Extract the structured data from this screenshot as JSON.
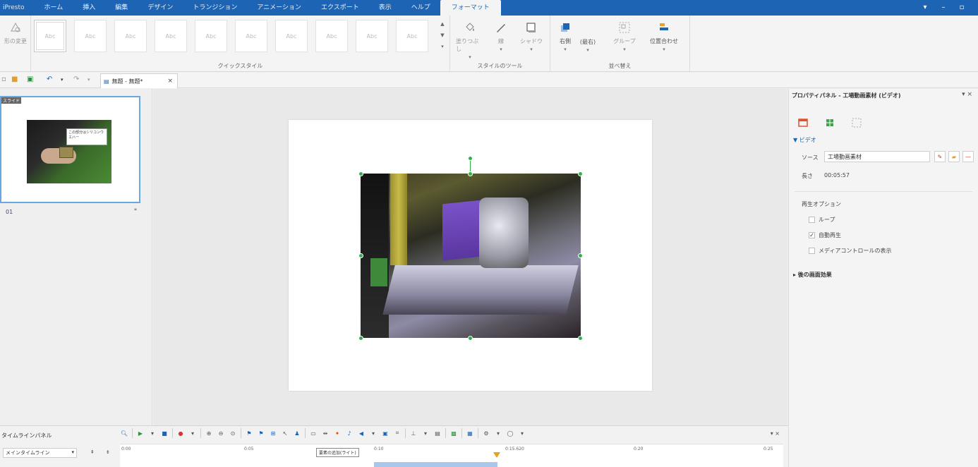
{
  "app": {
    "title": "iPresto"
  },
  "tabs": [
    "ホーム",
    "挿入",
    "編集",
    "デザイン",
    "トランジション",
    "アニメーション",
    "エクスポート",
    "表示",
    "ヘルプ",
    "フォーマット"
  ],
  "active_tab": "フォーマット",
  "ribbon": {
    "shape_change_label": "形の変更",
    "style_thumb_text": "Abc",
    "quick_styles_label": "クイックスタイル",
    "style_tools": {
      "fill": "塗りつぶし",
      "line": "線",
      "shadow": "シャドウ",
      "label": "スタイルのツール"
    },
    "arrange": {
      "bring": "右側",
      "send": "(最右)",
      "group": "グループ",
      "align": "位置合わせ",
      "label": "並べ替え"
    }
  },
  "document_tab": "無題 - 無題*",
  "slide_pane": {
    "thumb_label": "スライド",
    "callout_text": "この部分はシリコンウエハー",
    "slide_number": "01",
    "star": "*"
  },
  "property_panel": {
    "title": "プロパティパネル - 工場動画素材 (ビデオ)",
    "section": "▼ ビデオ",
    "source_label": "ソース",
    "source_value": "工場動画素材",
    "length_label": "長さ",
    "length_value": "00:05:57",
    "playback_label": "再生オプション",
    "options": [
      {
        "label": "ループ",
        "checked": false
      },
      {
        "label": "自動再生",
        "checked": true
      },
      {
        "label": "メディアコントロールの表示",
        "checked": false
      }
    ],
    "effects_label": "▸ 後の画面効果"
  },
  "timeline": {
    "title": "タイムラインパネル",
    "track_select": "メインタイムライン",
    "ticks": [
      "0:00",
      "0:05",
      "0:10",
      "0:15.620",
      "0:20",
      "0:25"
    ],
    "tooltip": "要素の追加(ライト)"
  },
  "colors": {
    "accent": "#1e64b4",
    "selection": "#2fb14b",
    "playhead": "#e8a21a"
  }
}
